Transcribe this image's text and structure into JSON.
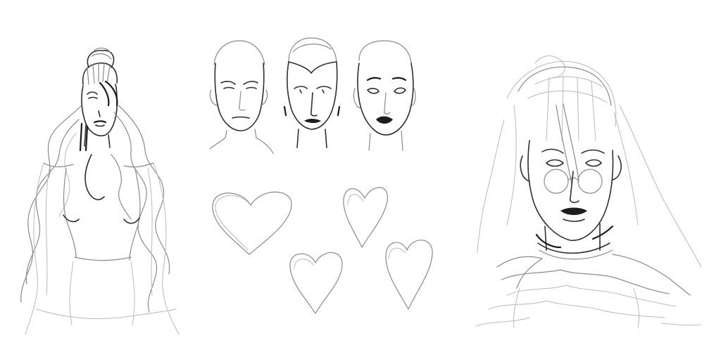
{
  "canvas": {
    "background": "#ffffff",
    "ink_color": "#2e2e2e",
    "sketch_color": "#b9b9b9"
  },
  "figures": [
    {
      "name": "long-haired-figure",
      "kind": "half-body sketch"
    },
    {
      "name": "face-study-1",
      "kind": "head sketch"
    },
    {
      "name": "face-study-2",
      "kind": "head sketch"
    },
    {
      "name": "face-study-3",
      "kind": "head sketch"
    },
    {
      "name": "heart-1",
      "kind": "heart sketch"
    },
    {
      "name": "heart-2",
      "kind": "heart sketch"
    },
    {
      "name": "heart-3",
      "kind": "heart sketch"
    },
    {
      "name": "heart-4",
      "kind": "heart sketch"
    },
    {
      "name": "veiled-portrait",
      "kind": "portrait sketch"
    }
  ]
}
